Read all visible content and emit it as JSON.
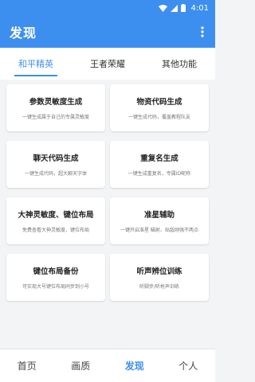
{
  "status_bar": {
    "time": "4:01"
  },
  "app_bar": {
    "title": "发现"
  },
  "tabs": [
    {
      "label": "和平精英",
      "active": true
    },
    {
      "label": "王者荣耀",
      "active": false
    },
    {
      "label": "其他功能",
      "active": false
    }
  ],
  "cards": [
    {
      "title": "参数灵敏度生成",
      "subtitle": "一键生成属于自己的专属灵敏度"
    },
    {
      "title": "物资代码生成",
      "subtitle": "一键生成代码，覆盖教程队友"
    },
    {
      "title": "聊天代码生成",
      "subtitle": "一键生成代码，超大聊天字体"
    },
    {
      "title": "重复名生成",
      "subtitle": "一键生成重复名，专属ID昵称"
    },
    {
      "title": "大神灵敏度、键位布局",
      "subtitle": "免费查看大神灵敏度、键位布局"
    },
    {
      "title": "准星辅助",
      "subtitle": "一键开启准星 瞄射、贴敌刚强不两点"
    },
    {
      "title": "键位布局备份",
      "subtitle": "可实现大号键位布局同步到小号"
    },
    {
      "title": "听声辨位训练",
      "subtitle": "听脚步/听枪声训练"
    }
  ],
  "bottom_nav": [
    {
      "label": "首页",
      "active": false
    },
    {
      "label": "画质",
      "active": false
    },
    {
      "label": "发现",
      "active": true
    },
    {
      "label": "个人",
      "active": false
    }
  ],
  "colors": {
    "primary": "#3d8fef",
    "background": "#f3f4f6"
  }
}
